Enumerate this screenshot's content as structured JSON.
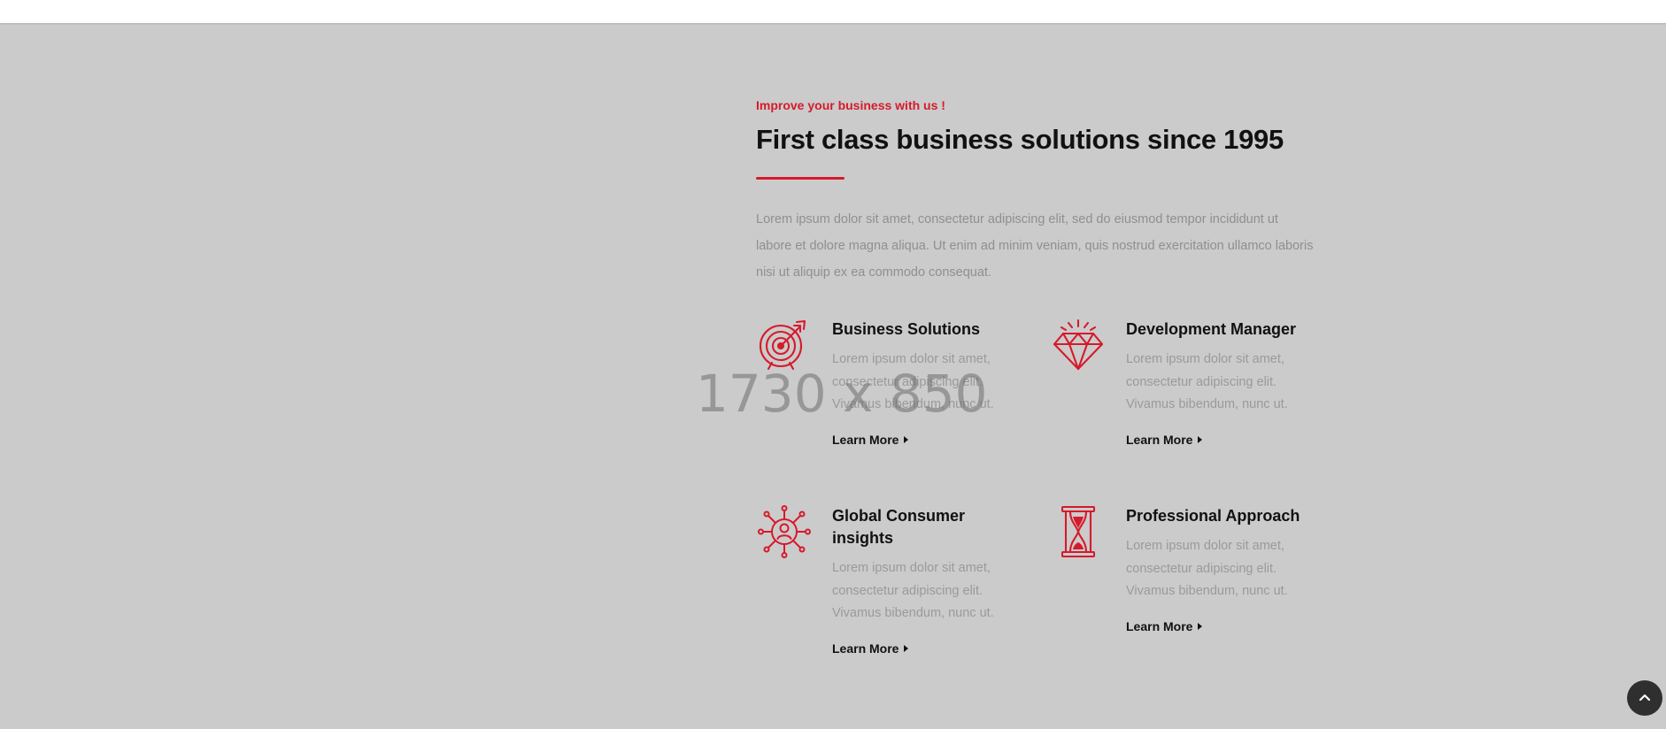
{
  "section": {
    "placeholder_label": "1730 x 850",
    "eyebrow": "Improve your business with us !",
    "heading": "First class business solutions since 1995",
    "intro": "Lorem ipsum dolor sit amet, consectetur adipiscing elit, sed do eiusmod tempor incididunt ut labore et dolore magna aliqua. Ut enim ad minim veniam, quis nostrud exercitation ullamco laboris nisi ut aliquip ex ea commodo consequat."
  },
  "features": [
    {
      "icon": "target-icon",
      "title": "Business Solutions",
      "desc": "Lorem ipsum dolor sit amet, consectetur adipiscing elit. Vivamus bibendum, nunc ut.",
      "cta": "Learn More"
    },
    {
      "icon": "diamond-icon",
      "title": "Development Manager",
      "desc": "Lorem ipsum dolor sit amet, consectetur adipiscing elit. Vivamus bibendum, nunc ut.",
      "cta": "Learn More"
    },
    {
      "icon": "network-user-icon",
      "title": "Global Consumer insights",
      "desc": "Lorem ipsum dolor sit amet, consectetur adipiscing elit. Vivamus bibendum, nunc ut.",
      "cta": "Learn More"
    },
    {
      "icon": "hourglass-icon",
      "title": "Professional Approach",
      "desc": "Lorem ipsum dolor sit amet, consectetur adipiscing elit. Vivamus bibendum, nunc ut.",
      "cta": "Learn More"
    }
  ],
  "colors": {
    "accent": "#d61a2b",
    "heading": "#111111",
    "muted_text": "#9a9a9a",
    "section_bg": "#cbcbcb",
    "scroll_button_bg": "#2f2f2f"
  },
  "scroll_top": {
    "icon": "chevron-up-icon"
  }
}
